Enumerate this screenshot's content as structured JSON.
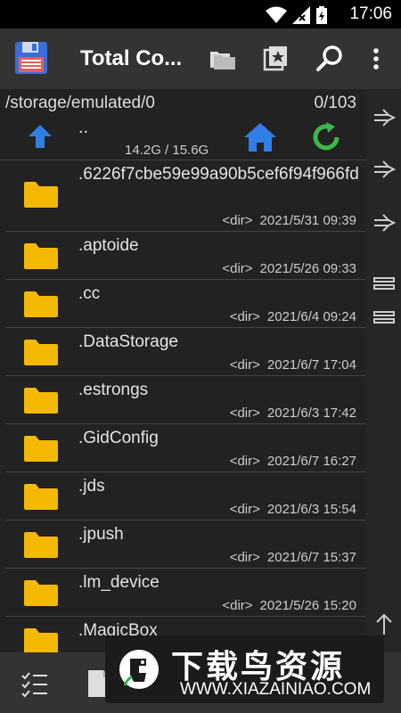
{
  "status": {
    "time": "17:06"
  },
  "appbar": {
    "title": "Total Co..."
  },
  "path": {
    "current": "/storage/emulated/0",
    "count": "0/103"
  },
  "updir": {
    "label": "..",
    "space": "14.2G / 15.6G"
  },
  "rows": [
    {
      "name": ".6226f7cbe59e99a90b5cef6f94f966fd",
      "type": "<dir>",
      "date": "2021/5/31",
      "time": "09:39",
      "tall": true
    },
    {
      "name": ".aptoide",
      "type": "<dir>",
      "date": "2021/5/26",
      "time": "09:33"
    },
    {
      "name": ".cc",
      "type": "<dir>",
      "date": "2021/6/4",
      "time": "09:24"
    },
    {
      "name": ".DataStorage",
      "type": "<dir>",
      "date": "2021/6/7",
      "time": "17:04"
    },
    {
      "name": ".estrongs",
      "type": "<dir>",
      "date": "2021/6/3",
      "time": "17:42"
    },
    {
      "name": ".GidConfig",
      "type": "<dir>",
      "date": "2021/6/7",
      "time": "16:27"
    },
    {
      "name": ".jds",
      "type": "<dir>",
      "date": "2021/6/3",
      "time": "15:54"
    },
    {
      "name": ".jpush",
      "type": "<dir>",
      "date": "2021/6/7",
      "time": "15:37"
    },
    {
      "name": ".lm_device",
      "type": "<dir>",
      "date": "2021/5/26",
      "time": "15:20"
    },
    {
      "name": ".MagicBox",
      "type": "",
      "date": "",
      "time": ""
    }
  ],
  "watermark": {
    "title": "下载鸟资源",
    "url": "WWW.XIAZAINIAO.COM"
  },
  "icons": {
    "folder_color": "#f5b800",
    "home_color": "#2f7fe6",
    "refresh_color": "#3cb84a",
    "up_color": "#2f7fe6"
  }
}
